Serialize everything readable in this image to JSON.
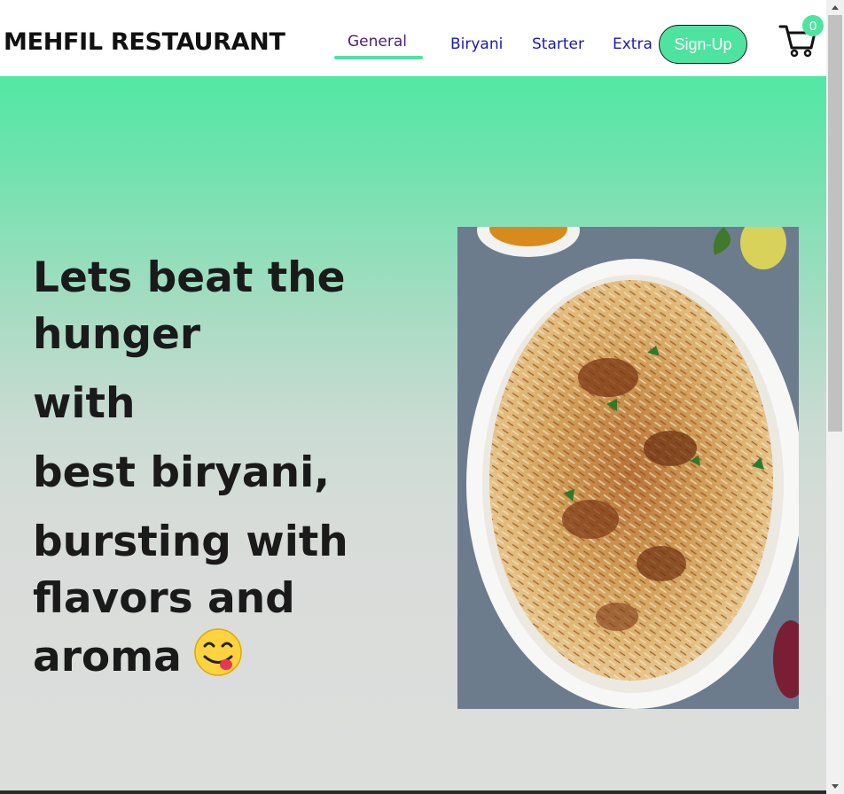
{
  "brand": {
    "name": "MEHFIL RESTAURANT"
  },
  "nav": {
    "links": [
      {
        "label": "General"
      },
      {
        "label": "Biryani"
      },
      {
        "label": "Starter"
      },
      {
        "label": "Extra"
      }
    ],
    "signup_label": "Sign-Up",
    "cart": {
      "icon": "cart-icon",
      "count": "0"
    }
  },
  "hero": {
    "lines": [
      "Lets beat the",
      "hunger",
      "with",
      "best biryani,",
      "bursting with",
      "flavors and",
      "aroma"
    ],
    "emoji": "yum-face-emoji",
    "image": "biryani-plate-photo"
  },
  "colors": {
    "accent": "#4fe3a0",
    "link": "#1a1ab0",
    "active_link": "#4b1f7a",
    "text": "#1a1a1a"
  }
}
